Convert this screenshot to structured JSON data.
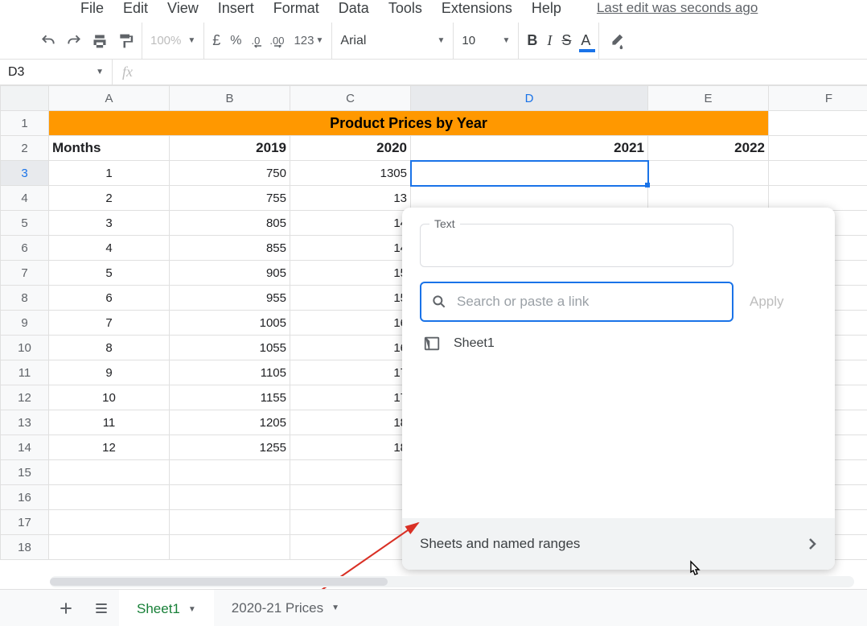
{
  "menu": {
    "items": [
      "File",
      "Edit",
      "View",
      "Insert",
      "Format",
      "Data",
      "Tools",
      "Extensions",
      "Help"
    ],
    "last_edit": "Last edit was seconds ago"
  },
  "toolbar": {
    "zoom": "100%",
    "currency": "£",
    "percent": "%",
    "dec_dec": ".0",
    "inc_dec": ".00",
    "numfmt": "123",
    "font": "Arial",
    "fontsize": "10",
    "bold": "B",
    "italic": "I",
    "strike": "S",
    "textcolor": "A"
  },
  "namebox": "D3",
  "fx_label": "fx",
  "columns": [
    "A",
    "B",
    "C",
    "D",
    "E",
    "F"
  ],
  "row_count": 18,
  "selected": {
    "row": 3,
    "col": "D"
  },
  "title_cell": "Product Prices by Year",
  "headers": {
    "A": "Months",
    "B": "2019",
    "C": "2020",
    "D": "2021",
    "E": "2022"
  },
  "data_rows": [
    {
      "A": "1",
      "B": "750",
      "C": "1305"
    },
    {
      "A": "2",
      "B": "755",
      "C": "13"
    },
    {
      "A": "3",
      "B": "805",
      "C": "14"
    },
    {
      "A": "4",
      "B": "855",
      "C": "14"
    },
    {
      "A": "5",
      "B": "905",
      "C": "15"
    },
    {
      "A": "6",
      "B": "955",
      "C": "15"
    },
    {
      "A": "7",
      "B": "1005",
      "C": "16"
    },
    {
      "A": "8",
      "B": "1055",
      "C": "16"
    },
    {
      "A": "9",
      "B": "1105",
      "C": "17"
    },
    {
      "A": "10",
      "B": "1155",
      "C": "17"
    },
    {
      "A": "11",
      "B": "1205",
      "C": "18"
    },
    {
      "A": "12",
      "B": "1255",
      "C": "18"
    }
  ],
  "link_popup": {
    "text_label": "Text",
    "search_placeholder": "Search or paste a link",
    "apply": "Apply",
    "suggestion": "Sheet1",
    "footer": "Sheets and named ranges"
  },
  "tabs": {
    "sheet1": "Sheet1",
    "sheet2": "2020-21 Prices"
  }
}
